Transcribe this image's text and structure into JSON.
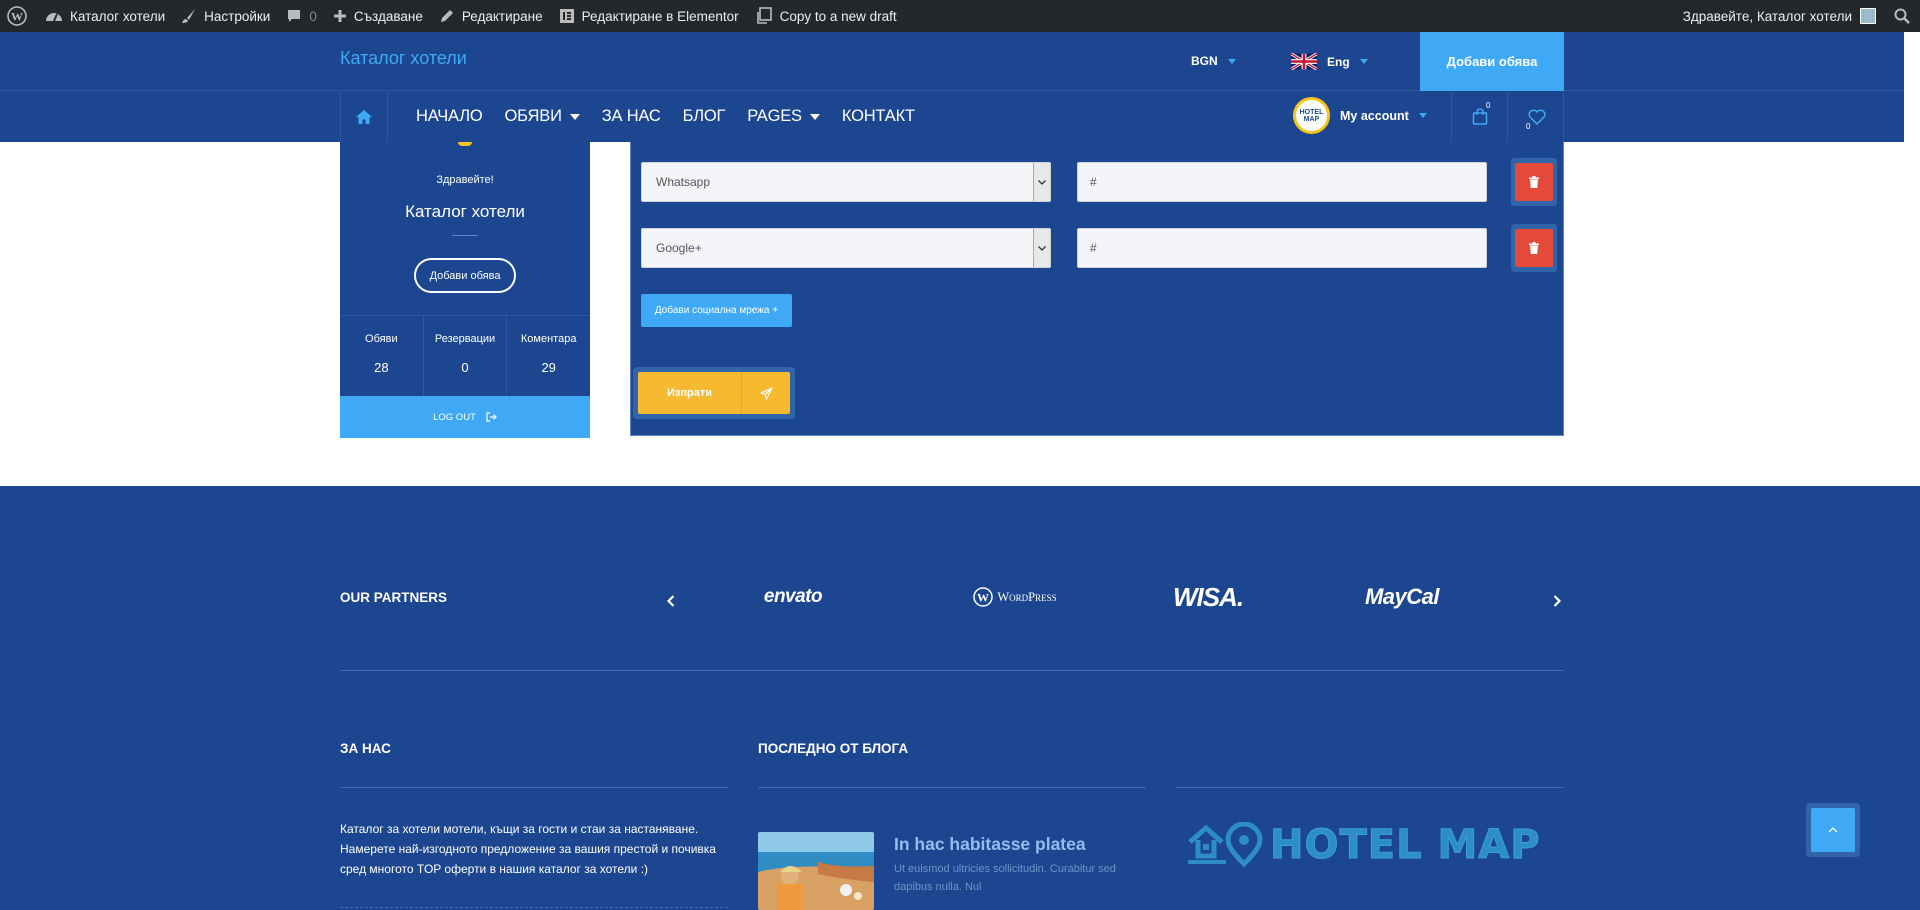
{
  "admin_bar": {
    "site_name": "Каталог хотели",
    "settings": "Настройки",
    "comments_count": "0",
    "create": "Създаване",
    "edit": "Редактиране",
    "edit_elementor": "Редактиране в Elementor",
    "copy_draft": "Copy to a new draft",
    "greeting": "Здравейте, Каталог хотели"
  },
  "header": {
    "logo_text": "Каталог хотели",
    "currency": "BGN",
    "language": "Eng",
    "add_ad_button": "Добави обява"
  },
  "nav": {
    "items": [
      {
        "label": "НАЧАЛО",
        "has_dropdown": false
      },
      {
        "label": "ОБЯВИ",
        "has_dropdown": true
      },
      {
        "label": "ЗА НАС",
        "has_dropdown": false
      },
      {
        "label": "БЛОГ",
        "has_dropdown": false
      },
      {
        "label": "PAGES",
        "has_dropdown": true
      },
      {
        "label": "КОНТАКТ",
        "has_dropdown": false
      }
    ],
    "account_label": "My account",
    "account_avatar_text": "HOTEL MAP",
    "cart_count": "0",
    "wishlist_count": "0"
  },
  "profile": {
    "greeting": "Здравейте!",
    "name": "Каталог хотели",
    "add_button": "Добави обява",
    "stats": [
      {
        "label": "Обяви",
        "value": "28"
      },
      {
        "label": "Резервации",
        "value": "0"
      },
      {
        "label": "Коментара",
        "value": "29"
      }
    ],
    "logout": "LOG OUT"
  },
  "social_form": {
    "rows": [
      {
        "network": "Whatsapp",
        "url_value": "#"
      },
      {
        "network": "Google+",
        "url_value": "#"
      }
    ],
    "add_button": "Добави социална мрежа +",
    "submit_button": "Изпрати"
  },
  "footer": {
    "partners_title": "OUR PARTNERS",
    "partners": [
      "envato",
      "WordPress",
      "WISA.",
      "MayCal"
    ],
    "about_title": "ЗА НАС",
    "about_text": "Каталог за хотели мотели, къщи за гости и стаи за настаняване. Намерете най-изгодното предложение за вашия престой и почивка сред многото TOP оферти в нашия каталог за хотели :)",
    "blog_title": "ПОСЛЕДНО ОТ БЛОГА",
    "blog_post_title": "In hac habitasse platea",
    "blog_post_excerpt": "Ut euismod ultricies sollicitudin. Curabitur sed dapibus nulla. Nul",
    "logo_text": "HOTEL MAP"
  },
  "colors": {
    "admin_bar_bg": "#23282d",
    "primary_blue": "#1d4690",
    "accent_blue": "#3fa9f5",
    "delete_red": "#e5493a",
    "submit_yellow": "#f7b92f"
  }
}
